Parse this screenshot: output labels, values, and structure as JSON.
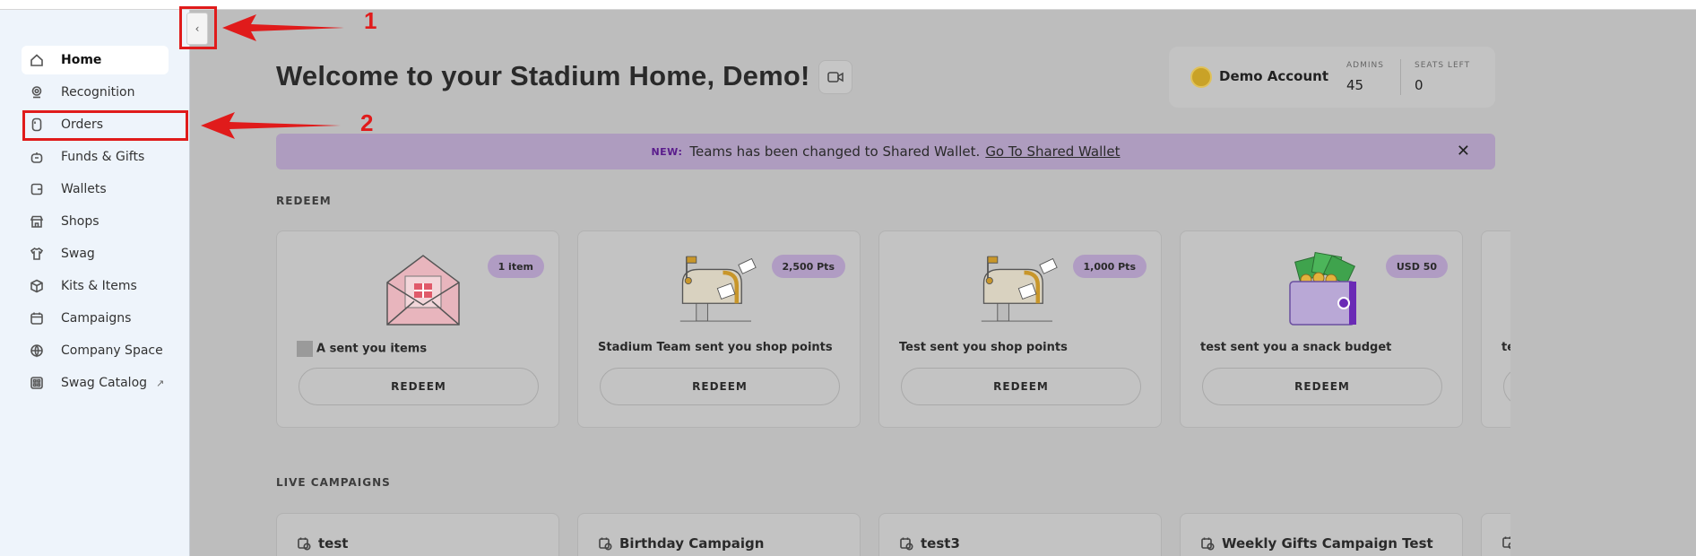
{
  "sidebar": {
    "items": [
      {
        "label": "Home",
        "icon": "home-icon"
      },
      {
        "label": "Recognition",
        "icon": "award-icon"
      },
      {
        "label": "Orders",
        "icon": "receipt-icon"
      },
      {
        "label": "Funds & Gifts",
        "icon": "gift-icon"
      },
      {
        "label": "Wallets",
        "icon": "wallet-icon"
      },
      {
        "label": "Shops",
        "icon": "store-icon"
      },
      {
        "label": "Swag",
        "icon": "shirt-icon"
      },
      {
        "label": "Kits & Items",
        "icon": "box-icon"
      },
      {
        "label": "Campaigns",
        "icon": "calendar-icon"
      },
      {
        "label": "Company Space",
        "icon": "globe-icon"
      },
      {
        "label": "Swag Catalog",
        "icon": "catalog-icon",
        "external": "↗"
      }
    ],
    "toggle_label": "‹"
  },
  "annotations": {
    "one": "1",
    "two": "2"
  },
  "header": {
    "title": "Welcome to your Stadium Home, Demo!"
  },
  "account": {
    "name": "Demo Account",
    "admins_label": "ADMINS",
    "admins_value": "45",
    "seats_label": "SEATS LEFT",
    "seats_value": "0"
  },
  "banner": {
    "tag": "NEW:",
    "text": "Teams has been changed to Shared Wallet.",
    "link": "Go To Shared Wallet",
    "close": "✕"
  },
  "redeem": {
    "section_label": "REDEEM",
    "cards": [
      {
        "badge": "1 item",
        "text": "A sent you items",
        "button": "REDEEM",
        "illustration": "envelope-gift-icon"
      },
      {
        "badge": "2,500 Pts",
        "text": "Stadium Team sent you shop points",
        "button": "REDEEM",
        "illustration": "mailbox-icon"
      },
      {
        "badge": "1,000 Pts",
        "text": "Test sent you shop points",
        "button": "REDEEM",
        "illustration": "mailbox-icon"
      },
      {
        "badge": "USD 50",
        "text": "test sent you a snack budget",
        "button": "REDEEM",
        "illustration": "wallet-cash-icon"
      },
      {
        "badge": "",
        "text": "te",
        "button": "",
        "illustration": ""
      }
    ]
  },
  "campaigns": {
    "section_label": "LIVE CAMPAIGNS",
    "cards": [
      {
        "title": "test"
      },
      {
        "title": "Birthday Campaign"
      },
      {
        "title": "test3"
      },
      {
        "title": "Weekly Gifts Campaign Test"
      },
      {
        "title": ""
      }
    ]
  },
  "colors": {
    "accent_red": "#e01b1b",
    "banner_purple": "#ae9cbf",
    "badge_purple": "#b09cc3",
    "sidebar_bg": "#eef4fb"
  }
}
